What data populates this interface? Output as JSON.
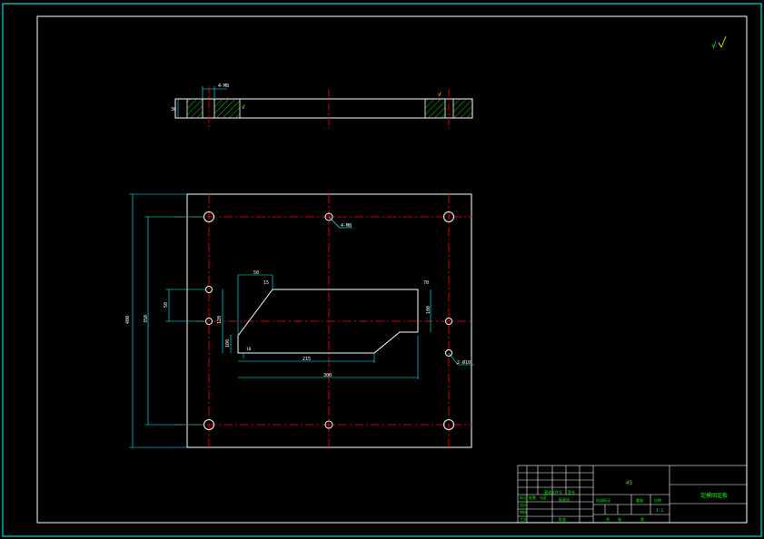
{
  "colors": {
    "background": "#000000",
    "outline": "#ffffff",
    "centerline": "#ff0000",
    "dimension": "#00ffff",
    "hatch": "#00ff00",
    "text": "#00ff00",
    "title_block": "#00ff00"
  },
  "roughness_note": "√",
  "side_view": {
    "hole_callout": "4-M8",
    "thickness_dim": "30"
  },
  "plan_view": {
    "hole_callout_top": "4-M8",
    "hole_callout_right": "2-Ø10",
    "dim_height_outer": "400",
    "dim_height_inner": "350",
    "dim_left_1": "50",
    "dim_left_2": "120",
    "dim_left_3": "100",
    "dim_slot_top": "50",
    "dim_slot_right": "70",
    "dim_slot_height": "100",
    "dim_small": "10",
    "dim_bottom_inner": "215",
    "dim_bottom_outer": "300",
    "dim_corner": "15"
  },
  "title_block": {
    "material": "45",
    "part_name": "定模固定板",
    "scale": "1:2",
    "labels": [
      "标记",
      "处数",
      "分区",
      "更改文件号",
      "签名",
      "设计",
      "标准化",
      "审核",
      "工艺",
      "批准",
      "阶段标记",
      "重量",
      "比例",
      "共",
      "张",
      "第"
    ]
  }
}
